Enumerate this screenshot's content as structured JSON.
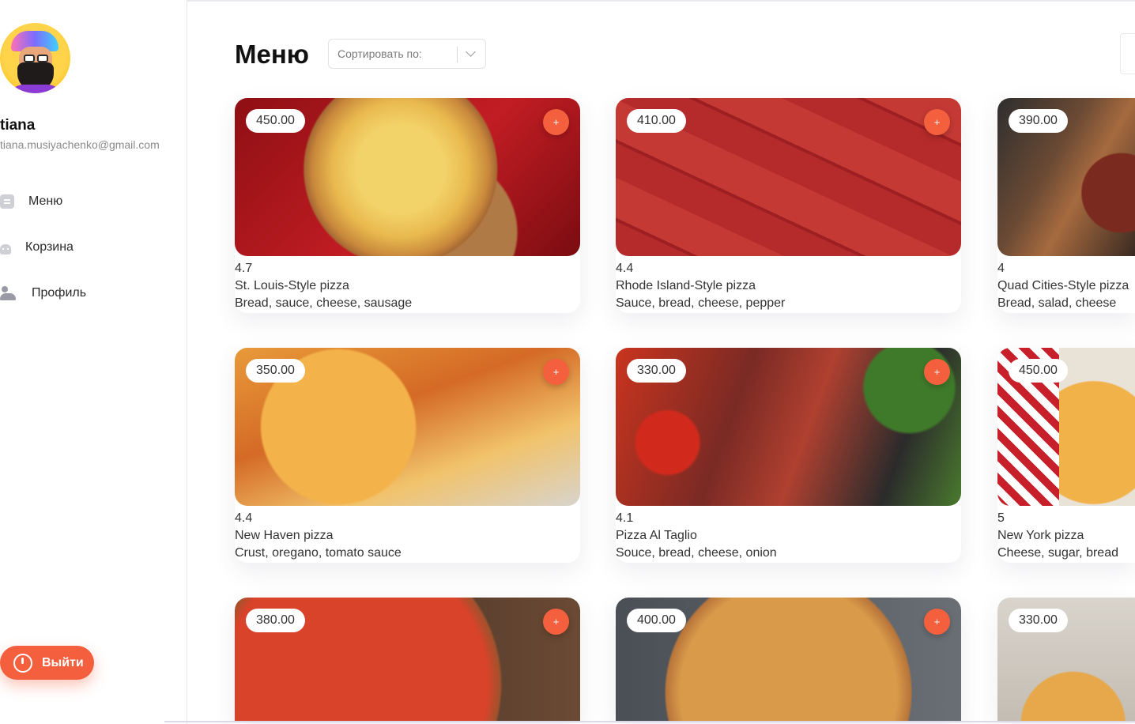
{
  "user": {
    "name": "tiana",
    "email": "tiana.musiyachenko@gmail.com"
  },
  "sidebar": {
    "items": [
      {
        "label": "Меню",
        "icon": "menu-icon"
      },
      {
        "label": "Корзина",
        "icon": "cart-icon"
      },
      {
        "label": "Профиль",
        "icon": "profile-icon"
      }
    ],
    "logout_label": "Выйти"
  },
  "header": {
    "title": "Меню",
    "sort_placeholder": "Сортировать по:"
  },
  "accent_color": "#f4603d",
  "products": [
    {
      "price": "450.00",
      "rating": "4.7",
      "title": "St. Louis-Style pizza",
      "desc": "Bread, sauce, cheese, sausage"
    },
    {
      "price": "410.00",
      "rating": "4.4",
      "title": "Rhode Island-Style pizza",
      "desc": "Sauce, bread, cheese, pepper"
    },
    {
      "price": "390.00",
      "rating": "4",
      "title": "Quad Cities-Style pizza",
      "desc": "Bread, salad, cheese"
    },
    {
      "price": "350.00",
      "rating": "4.4",
      "title": "New Haven pizza",
      "desc": "Crust, oregano, tomato sauce"
    },
    {
      "price": "330.00",
      "rating": "4.1",
      "title": "Pizza Al Taglio",
      "desc": "Souce, bread, cheese, onion"
    },
    {
      "price": "450.00",
      "rating": "5",
      "title": "New York pizza",
      "desc": "Cheese, sugar, bread"
    },
    {
      "price": "380.00",
      "rating": "",
      "title": "",
      "desc": ""
    },
    {
      "price": "400.00",
      "rating": "",
      "title": "",
      "desc": ""
    },
    {
      "price": "330.00",
      "rating": "",
      "title": "",
      "desc": ""
    }
  ],
  "add_button_label": "+"
}
